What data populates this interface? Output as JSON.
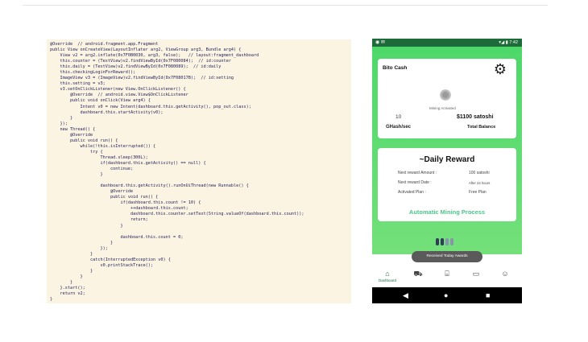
{
  "code": {
    "lines": [
      "@Override  // android.fragment.app.Fragment",
      "public View onCreateView(LayoutInflater arg2, ViewGroup arg3, Bundle arg4) {",
      "    View v2 = arg2.inflate(0x7F0B0030, arg3, false);   // layout:fragment_dashboard",
      "    this.counter = (TextView)v2.findViewById(0x7F080084);  // id:counter",
      "    this.daily = (TextView)v2.findViewById(0x7F080089);  // id:daily",
      "    this.checkingLoginForReward();",
      "    ImageView v3 = (ImageView)v2.findViewById(0x7F08017B);  // id:setting",
      "    this.setting = v3;",
      "    v3.setOnClickListener(new View.OnClickListener() {",
      "        @Override  // android.view.View$OnClickListener",
      "        public void onClick(View arg4) {",
      "            Intent v0 = new Intent(dashboard.this.getActivity(), pop_out.class);",
      "            dashboard.this.startActivity(v0);",
      "        }",
      "    });",
      "    new Thread() {",
      "        @Override",
      "        public void run() {",
      "            while(!this.isInterrupted()) {",
      "                try {",
      "                    Thread.sleep(300L);",
      "                    if(dashboard.this.getActivity() == null) {",
      "                        continue;",
      "                    }",
      "",
      "                    dashboard.this.getActivity().runOnUiThread(new Runnable() {",
      "                        @Override",
      "                        public void run() {",
      "                            if(dashboard.this.count != 10) {",
      "                                ++dashboard.this.count;",
      "                                dashboard.this.counter.setText(String.valueOf(dashboard.this.count));",
      "                                return;",
      "                            }",
      "",
      "                            dashboard.this.count = 0;",
      "                        }",
      "                    });",
      "                }",
      "                catch(InterruptedException v0) {",
      "                    v0.printStackTrace();",
      "                }",
      "            }",
      "        }",
      "    }.start();",
      "    return v2;",
      "}"
    ]
  },
  "phone": {
    "status": {
      "left_icons": "◉ ✉",
      "time": "▾◢ ▮ 7:42"
    },
    "top_card": {
      "title": "Bito Cash",
      "mining_status": "Mining Activated",
      "hash_value": "10",
      "hash_label": "GHash/sec",
      "balance_value": "$1100 satoshi",
      "balance_label": "Total Balance"
    },
    "reward_card": {
      "title": "~Daily Reward",
      "rows": [
        {
          "label": "Next reward Amount :",
          "value": "100  satoshi"
        },
        {
          "label": "Next reward Date :",
          "value": "After 24 hours"
        },
        {
          "label": "Activated Plan :",
          "value": "Free Plan"
        }
      ],
      "auto_mining": "Automatic Mining Process"
    },
    "toast": "Received Today Awards",
    "bottom_nav": [
      {
        "icon": "home-icon",
        "label": "Dashboard"
      },
      {
        "icon": "car-icon",
        "label": ""
      },
      {
        "icon": "bank-icon",
        "label": ""
      },
      {
        "icon": "card-icon",
        "label": ""
      },
      {
        "icon": "people-icon",
        "label": ""
      }
    ],
    "colors": {
      "status_bar": "#1e6b3a",
      "background_green": "#4ed86a",
      "accent_teal": "#4cc48c"
    }
  }
}
